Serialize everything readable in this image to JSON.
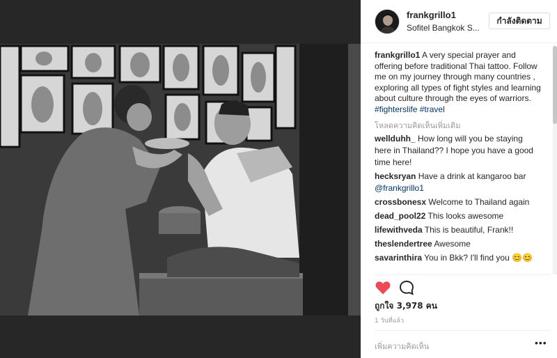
{
  "post": {
    "author": "frankgrillo1",
    "location": "Sofitel Bangkok S...",
    "follow_label": "กำลังติดตาม",
    "caption_user": "frankgrillo1",
    "caption_text": " A very special prayer and offering before traditional Thai tattoo. Follow me on my journey through many countries , exploring all types of fight styles and learning about culture through the eyes of warriors. ",
    "hashtags": [
      "#fighterslife",
      "#travel"
    ],
    "load_more": "โหลดความคิดเห็นเพิ่มเติม",
    "comments": [
      {
        "user": "wellduhh_",
        "text": " How long will you be staying here in Thailand?? I hope you have a good time here!"
      },
      {
        "user": "hecksryan",
        "text": " Have a drink at kangaroo bar ",
        "mention": "@frankgrillo1"
      },
      {
        "user": "crossbonesx",
        "text": " Welcome to Thailand again"
      },
      {
        "user": "dead_pool22",
        "text": " This looks awesome"
      },
      {
        "user": "lifewithveda",
        "text": " This is beautiful, Frank!!"
      },
      {
        "user": "theslendertree",
        "text": " Awesome"
      },
      {
        "user": "savarinthira",
        "text": " You in Bkk? I'll find you 😊😊"
      }
    ],
    "likes_text": "ถูกใจ 3,978 คน",
    "time_ago": "1 วันที่แล้ว",
    "add_comment_placeholder": "เพิ่มความคิดเห็น",
    "more_options": "•••"
  },
  "icons": {
    "like": "heart-icon",
    "comment": "speech-bubble-icon",
    "like_color": "#ed4956"
  }
}
